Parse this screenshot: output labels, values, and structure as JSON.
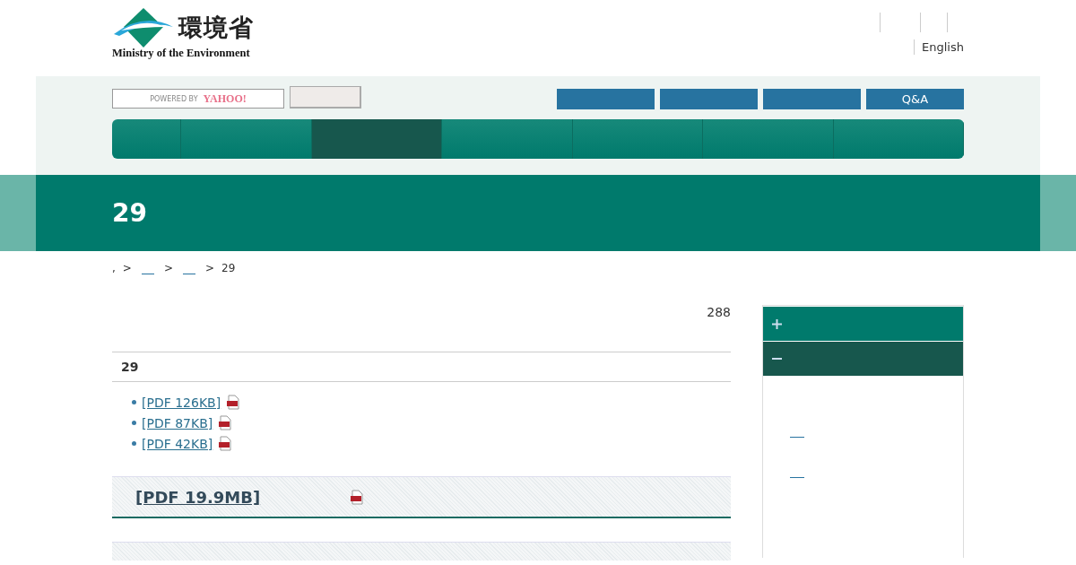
{
  "header": {
    "logo": {
      "name": "環境省",
      "subtitle": "Ministry of the Environment"
    },
    "language": "English"
  },
  "search": {
    "powered_by": "POWERED BY",
    "brand": "YAHOO!"
  },
  "qa_link": "Q&A",
  "nav": [
    {
      "selected": false
    },
    {
      "selected": false
    },
    {
      "selected": true
    },
    {
      "selected": false
    },
    {
      "selected": false
    },
    {
      "selected": false
    },
    {
      "selected": false
    }
  ],
  "page_title": "29",
  "breadcrumb": [
    {
      "kind": "text",
      "text": ","
    },
    {
      "kind": "sep",
      "text": ">"
    },
    {
      "kind": "link"
    },
    {
      "kind": "sep",
      "text": ">"
    },
    {
      "kind": "link"
    },
    {
      "kind": "sep",
      "text": ">"
    },
    {
      "kind": "text",
      "text": "29"
    }
  ],
  "count": "288",
  "section": {
    "title": "29",
    "files": [
      {
        "label": "[PDF 126KB]"
      },
      {
        "label": "[PDF 87KB]"
      },
      {
        "label": "[PDF 42KB]"
      }
    ]
  },
  "featured": {
    "label": "[PDF 19.9MB]"
  },
  "sidebar": [
    {
      "expanded": false
    },
    {
      "expanded": true
    }
  ]
}
